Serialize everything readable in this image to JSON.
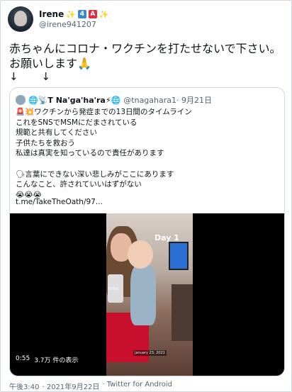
{
  "author": {
    "name": "Irene",
    "badges": [
      "✨",
      "4",
      "A",
      "✨"
    ],
    "handle": "@irene941207"
  },
  "tweet": {
    "text": "赤ちゃんにコロナ・ワクチンを打たせないで下さい。お願いします🙏",
    "arrows": "↓ ↓"
  },
  "quote": {
    "name": "🌐📡T Na'ga'ha'ra⚡🌐",
    "handle": "@tnagahara1",
    "date": "· 9月21日",
    "text": "🚨💥ワクチンから発症までの13日間のタイムライン\nこれをSNSでMSMにだまされている\n規範と共有してください\n子供たちを救おう\n 私達は真実を知っているので責任があります\n\n🗣言葉にできない深い悲しみがここにあります\nこんなこと、許されていいはずがない\n😭😭😭",
    "link": "t.me/TakeTheOath/97..."
  },
  "video": {
    "day_label": "Day 1",
    "date_overlay": "January 23, 2021",
    "watermark": "TikTok",
    "duration": "0:55",
    "views": "3.7万 件の表示"
  },
  "footer": {
    "time": "午後3:40",
    "date": "· 2021年9月22日",
    "source": "· Twitter for Android"
  },
  "colors": {
    "text": "#0f1419",
    "muted": "#536471",
    "border": "#cfd9de"
  }
}
